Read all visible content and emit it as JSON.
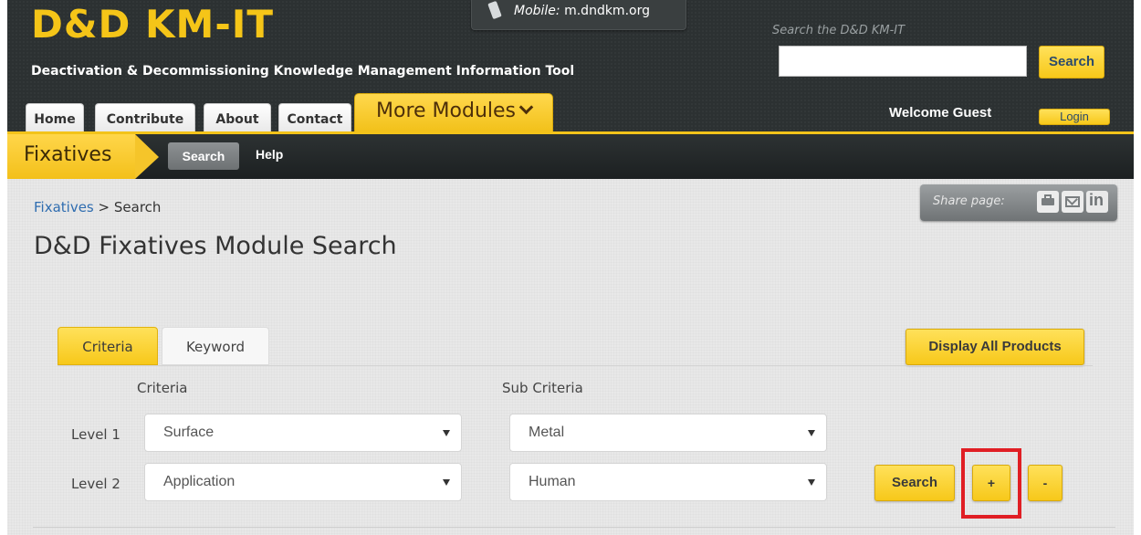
{
  "header": {
    "logo": "D&D KM-IT",
    "tagline": "Deactivation & Decommissioning Knowledge Management Information Tool",
    "mobile_label": "Mobile:",
    "mobile_url": "m.dndkm.org",
    "search_hint": "Search the D&D KM-IT",
    "search_value": "",
    "search_button": "Search",
    "welcome": "Welcome Guest",
    "login": "Login"
  },
  "nav": {
    "tabs": [
      "Home",
      "Contribute",
      "About",
      "Contact"
    ],
    "more_modules": "More Modules"
  },
  "module_bar": {
    "title": "Fixatives",
    "search": "Search",
    "help": "Help"
  },
  "content": {
    "breadcrumb_link": "Fixatives",
    "breadcrumb_sep": ">",
    "breadcrumb_current": "Search",
    "share_label": "Share page:",
    "page_title": "D&D Fixatives Module Search"
  },
  "search_panel": {
    "tabs": [
      "Criteria",
      "Keyword"
    ],
    "active_tab": "Criteria",
    "display_all": "Display All Products",
    "col_criteria": "Criteria",
    "col_sub_criteria": "Sub Criteria",
    "rows": [
      {
        "label": "Level 1",
        "criteria": "Surface",
        "sub_criteria": "Metal"
      },
      {
        "label": "Level 2",
        "criteria": "Application",
        "sub_criteria": "Human"
      }
    ],
    "search_button": "Search",
    "add_button": "+",
    "remove_button": "-"
  },
  "colors": {
    "accent_yellow": "#f7c81a",
    "header_dark": "#2c3132",
    "highlight_red": "#e01e24",
    "link_blue": "#2f6db0"
  },
  "icons": [
    "mobile-phone-icon",
    "print-icon",
    "mail-icon",
    "linkedin-icon",
    "chevron-down-icon",
    "dropdown-caret-icon"
  ]
}
